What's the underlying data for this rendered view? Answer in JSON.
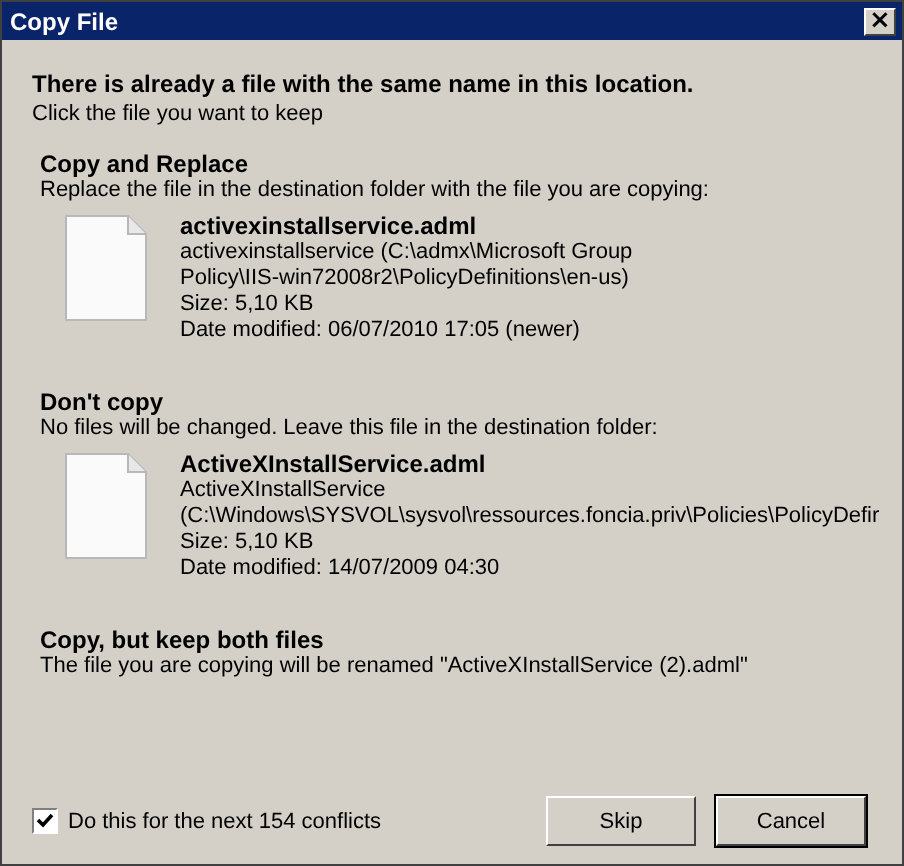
{
  "window": {
    "title": "Copy File",
    "close": "×"
  },
  "heading": "There is already a file with the same name in this location.",
  "subheading": "Click the file you want to keep",
  "options": [
    {
      "kind": "file",
      "title": "Copy and Replace",
      "description": "Replace the file in the destination folder with the file you are copying:",
      "file_name": "activexinstallservice.adml",
      "details": [
        "activexinstallservice (C:\\admx\\Microsoft Group Policy\\IIS-win72008r2\\PolicyDefinitions\\en-us)",
        "Size: 5,10 KB",
        "Date modified: 06/07/2010 17:05 (newer)"
      ]
    },
    {
      "kind": "file",
      "title": "Don't copy",
      "description": "No files will be changed. Leave this file in the destination folder:",
      "file_name": "ActiveXInstallService.adml",
      "details": [
        "ActiveXInstallService",
        "(C:\\Windows\\SYSVOL\\sysvol\\ressources.foncia.priv\\Policies\\PolicyDefir",
        "Size: 5,10 KB",
        "Date modified: 14/07/2009 04:30"
      ]
    },
    {
      "kind": "plain",
      "title": "Copy, but keep both files",
      "description": "The file you are copying will be renamed \"ActiveXInstallService (2).adml\""
    }
  ],
  "apply_all": {
    "label": "Do this for the next 154 conflicts",
    "checked": true
  },
  "buttons": [
    "Skip",
    "Cancel"
  ]
}
